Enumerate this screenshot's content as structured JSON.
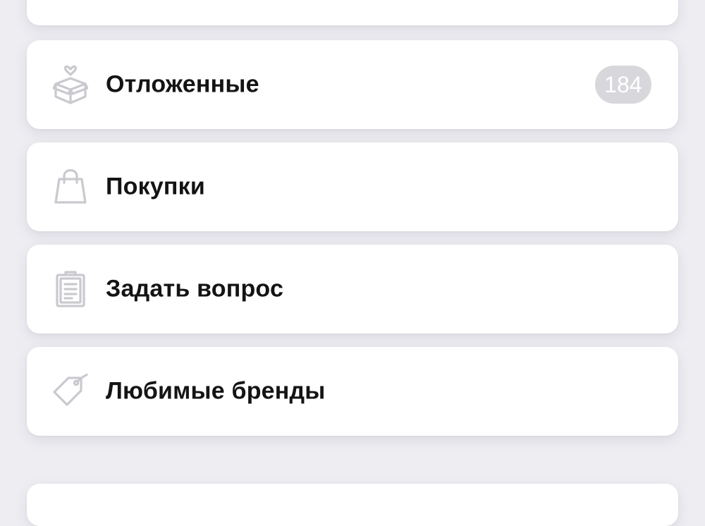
{
  "menu": {
    "items": [
      {
        "label": "Отложенные",
        "icon": "gift-box-heart-icon",
        "count": "184"
      },
      {
        "label": "Покупки",
        "icon": "shopping-bag-icon"
      },
      {
        "label": "Задать вопрос",
        "icon": "clipboard-icon"
      },
      {
        "label": "Любимые бренды",
        "icon": "price-tag-icon"
      }
    ]
  },
  "colors": {
    "background": "#eeedf2",
    "card": "#ffffff",
    "icon": "#c9c9cf",
    "badge": "#d8d8dc",
    "text": "#141414"
  }
}
